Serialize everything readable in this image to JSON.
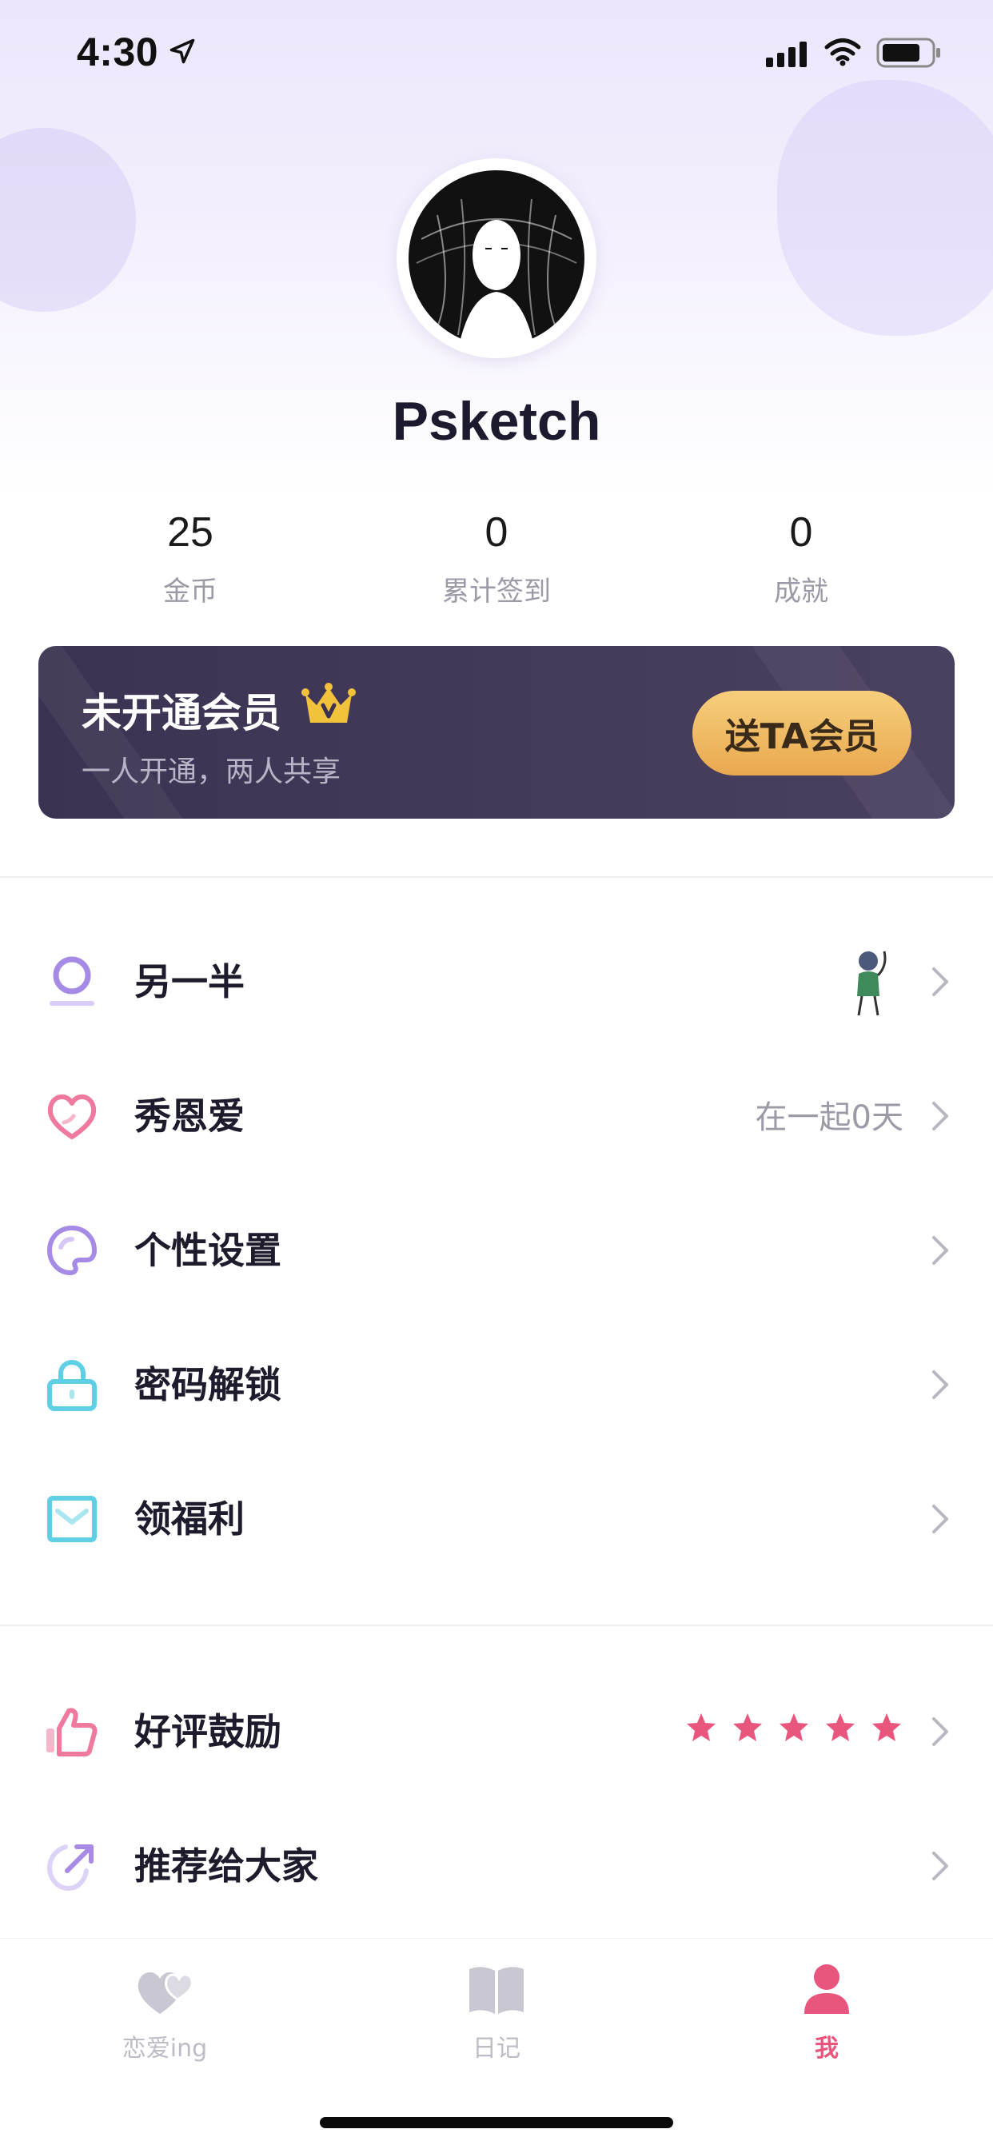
{
  "status_bar": {
    "time": "4:30"
  },
  "profile": {
    "username": "Psketch"
  },
  "stats": [
    {
      "value": "25",
      "label": "金币"
    },
    {
      "value": "0",
      "label": "累计签到"
    },
    {
      "value": "0",
      "label": "成就"
    }
  ],
  "vip": {
    "title": "未开通会员",
    "subtitle": "一人开通，两人共享",
    "button": "送TA会员"
  },
  "menu": {
    "partner": {
      "label": "另一半"
    },
    "show_love": {
      "label": "秀恩爱",
      "value": "在一起0天"
    },
    "personalize": {
      "label": "个性设置"
    },
    "password": {
      "label": "密码解锁"
    },
    "benefits": {
      "label": "领福利"
    },
    "rate": {
      "label": "好评鼓励",
      "stars": 5
    },
    "recommend": {
      "label": "推荐给大家"
    }
  },
  "tabbar": {
    "tabs": [
      {
        "label": "恋爱ing",
        "icon": "hearts-icon",
        "active": false
      },
      {
        "label": "日记",
        "icon": "book-icon",
        "active": false
      },
      {
        "label": "我",
        "icon": "person-icon",
        "active": true
      }
    ]
  },
  "colors": {
    "accent_pink": "#e8557d",
    "purple": "#a58be6",
    "cyan": "#5fcfe6",
    "vip_bg": "#3c3352",
    "vip_gold": "#f0b860"
  }
}
